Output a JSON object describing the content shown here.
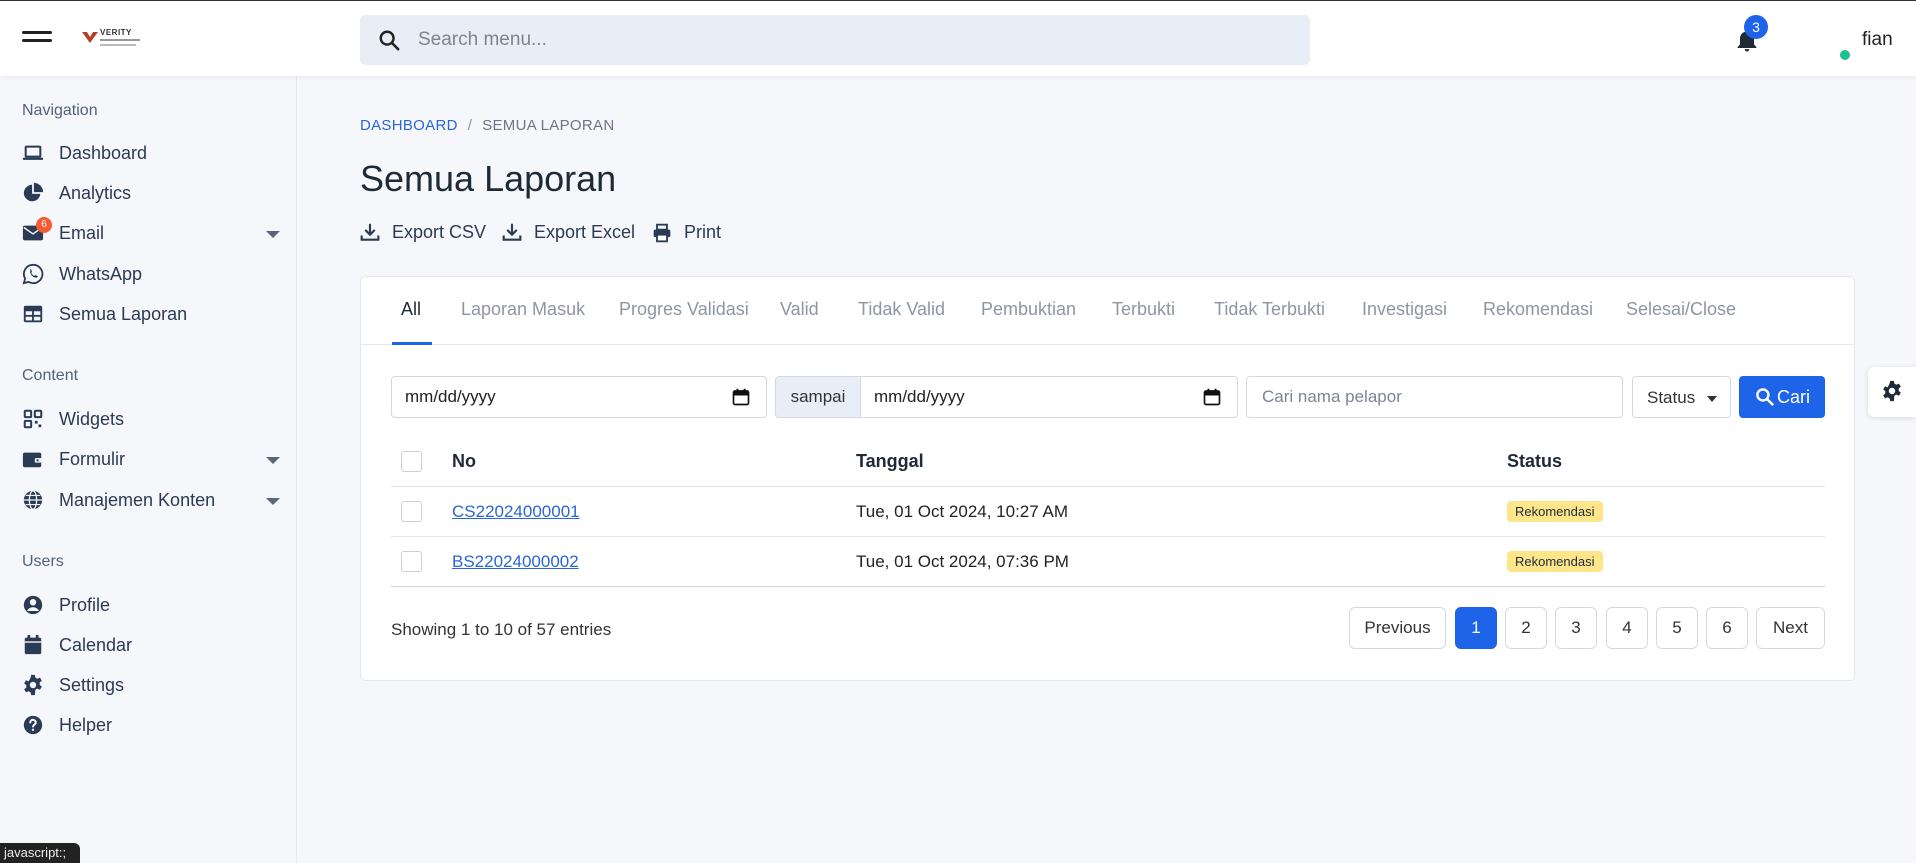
{
  "header": {
    "logo_text": "VERITY",
    "search_placeholder": "Search menu...",
    "notification_count": "3",
    "username": "fian"
  },
  "sidebar": {
    "sections": [
      {
        "label": "Navigation",
        "items": [
          {
            "label": "Dashboard",
            "icon": "laptop-icon"
          },
          {
            "label": "Analytics",
            "icon": "pie-chart-icon"
          },
          {
            "label": "Email",
            "icon": "envelope-icon",
            "badge": "6",
            "dropdown": true
          },
          {
            "label": "WhatsApp",
            "icon": "whatsapp-icon"
          },
          {
            "label": "Semua Laporan",
            "icon": "table-icon"
          }
        ]
      },
      {
        "label": "Content",
        "items": [
          {
            "label": "Widgets",
            "icon": "widgets-icon"
          },
          {
            "label": "Formulir",
            "icon": "wallet-icon",
            "dropdown": true
          },
          {
            "label": "Manajemen Konten",
            "icon": "globe-icon",
            "dropdown": true
          }
        ]
      },
      {
        "label": "Users",
        "items": [
          {
            "label": "Profile",
            "icon": "user-circle-icon"
          },
          {
            "label": "Calendar",
            "icon": "calendar-icon"
          },
          {
            "label": "Settings",
            "icon": "gear-icon"
          },
          {
            "label": "Helper",
            "icon": "question-circle-icon"
          }
        ]
      }
    ]
  },
  "breadcrumb": {
    "root": "DASHBOARD",
    "separator": "/",
    "current": "SEMUA LAPORAN"
  },
  "page": {
    "title": "Semua Laporan",
    "actions": [
      "Export CSV",
      "Export Excel",
      "Print"
    ]
  },
  "tabs": [
    "All",
    "Laporan Masuk",
    "Progres Validasi",
    "Valid",
    "Tidak Valid",
    "Pembuktian",
    "Terbukti",
    "Tidak Terbukti",
    "Investigasi",
    "Rekomendasi",
    "Selesai/Close"
  ],
  "filters": {
    "date_from": "mm/dd/yyyy",
    "range_label": "sampai",
    "date_to": "mm/dd/yyyy",
    "name_placeholder": "Cari nama pelapor",
    "status_label": "Status",
    "search_button": "Cari"
  },
  "table": {
    "headers": [
      "No",
      "Tanggal",
      "Status"
    ],
    "rows": [
      {
        "no": "CS22024000001",
        "tanggal": "Tue, 01 Oct 2024, 10:27 AM",
        "status": "Rekomendasi"
      },
      {
        "no": "BS22024000002",
        "tanggal": "Tue, 01 Oct 2024, 07:36 PM",
        "status": "Rekomendasi"
      }
    ]
  },
  "pagination": {
    "summary": "Showing 1 to 10 of 57 entries",
    "previous": "Previous",
    "pages": [
      "1",
      "2",
      "3",
      "4",
      "5",
      "6"
    ],
    "current_page": "1",
    "next": "Next"
  },
  "status_bar": "javascript:;",
  "colors": {
    "accent": "#1d64e8",
    "badge_yellow": "#fde68a",
    "mail_badge": "#f45d34",
    "online": "#1fbf8f"
  }
}
